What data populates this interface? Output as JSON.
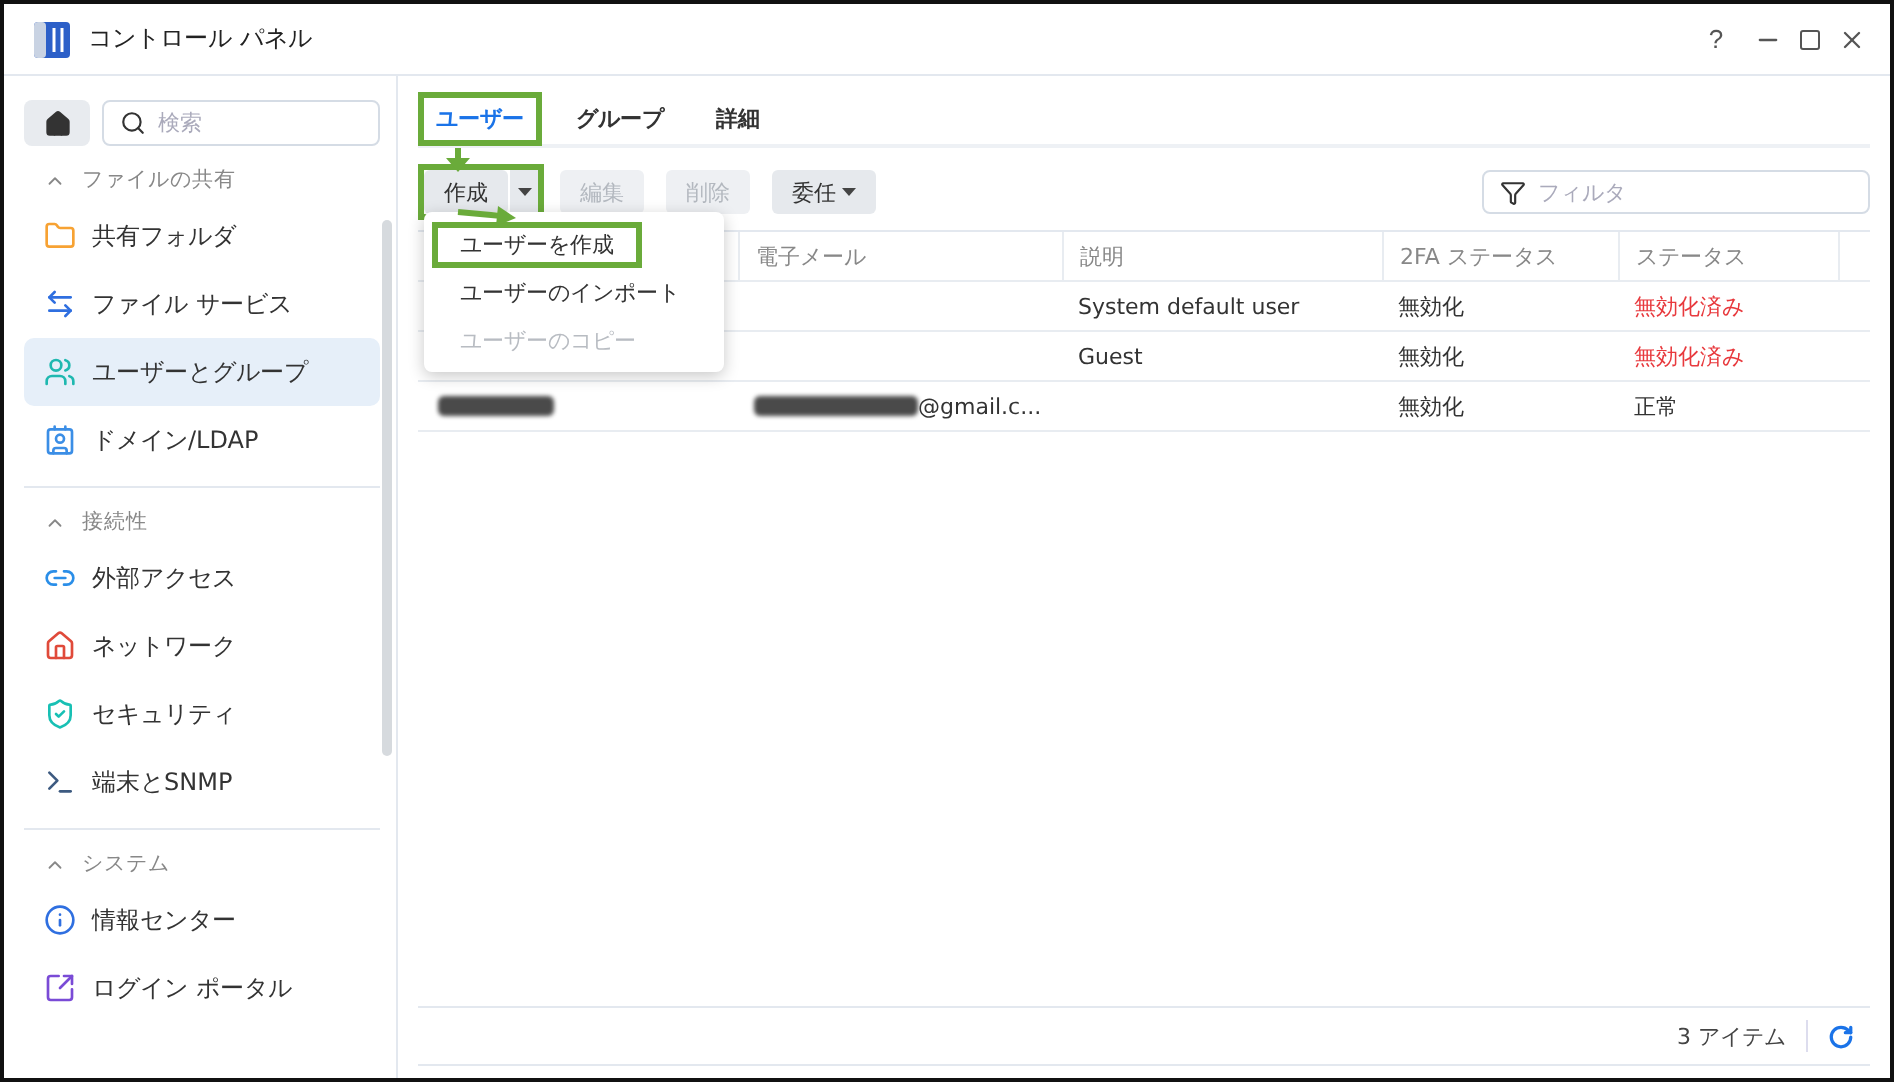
{
  "window": {
    "title": "コントロール パネル",
    "controls": [
      "?"
    ]
  },
  "sidebar": {
    "search": {
      "placeholder": "検索"
    },
    "sections": [
      {
        "title": "ファイルの共有",
        "expanded": true,
        "items": [
          {
            "label": "共有フォルダ",
            "selected": false
          },
          {
            "label": "ファイル サービス",
            "selected": false
          },
          {
            "label": "ユーザーとグループ",
            "selected": true
          },
          {
            "label": "ドメイン/LDAP",
            "selected": false
          }
        ]
      },
      {
        "title": "接続性",
        "expanded": true,
        "items": [
          {
            "label": "外部アクセス",
            "selected": false
          },
          {
            "label": "ネットワーク",
            "selected": false
          },
          {
            "label": "セキュリティ",
            "selected": false
          },
          {
            "label": "端末とSNMP",
            "selected": false
          }
        ]
      },
      {
        "title": "システム",
        "expanded": true,
        "items": [
          {
            "label": "情報センター",
            "selected": false
          },
          {
            "label": "ログイン ポータル",
            "selected": false
          }
        ]
      }
    ]
  },
  "tabs": [
    {
      "label": "ユーザー",
      "selected": true,
      "highlighted": true
    },
    {
      "label": "グループ",
      "selected": false,
      "highlighted": false
    },
    {
      "label": "詳細",
      "selected": false,
      "highlighted": false
    }
  ],
  "toolbar": {
    "buttons": [
      {
        "label": "作成",
        "kind": "split",
        "disabled": false,
        "highlighted": true
      },
      {
        "label": "編集",
        "kind": "plain",
        "disabled": true,
        "highlighted": false
      },
      {
        "label": "削除",
        "kind": "plain",
        "disabled": true,
        "highlighted": false
      },
      {
        "label": "委任",
        "kind": "dropdown",
        "disabled": false,
        "highlighted": false
      }
    ],
    "filter": {
      "placeholder": "フィルタ"
    }
  },
  "menu": {
    "items": [
      {
        "label": "ユーザーを作成",
        "disabled": false,
        "highlighted": true
      },
      {
        "label": "ユーザーのインポート",
        "disabled": false,
        "highlighted": false
      },
      {
        "label": "ユーザーのコピー",
        "disabled": true,
        "highlighted": false
      }
    ]
  },
  "table": {
    "columns": [
      "電子メール",
      "説明",
      "2FA ステータス",
      "ステータス"
    ],
    "rows": [
      {
        "description": "System default user",
        "twofa": "無効化",
        "status": "無効化済み",
        "color": "#e8393d"
      },
      {
        "description": "Guest",
        "twofa": "無効化",
        "status": "無効化済み",
        "color": "#e8393d"
      },
      {
        "name_redacted": true,
        "email_redacted": true,
        "email": "@gmail.c...",
        "twofa": "無効化",
        "status": "正常",
        "color": "#333333"
      }
    ]
  },
  "status_bar": {
    "count": "3 アイテム"
  }
}
